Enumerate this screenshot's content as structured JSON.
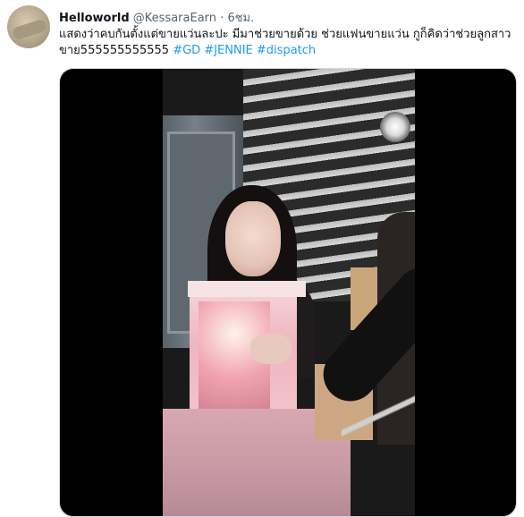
{
  "tweet": {
    "author_name": "Helloworld",
    "author_handle": "@KessaraEarn",
    "separator": "·",
    "time_ago": "6ชม.",
    "text_main": "แสดงว่าคบกันตั้งแต่ขายแว่นละปะ มีมาช่วยขายด้วย ช่วยแฟนขายแว่น กูก็คิดว่าช่วยลูกสาวขาย555555555555",
    "hashtags": [
      "#GD",
      "#JENNIE",
      "#dispatch"
    ]
  },
  "media": {
    "kind": "video-frame",
    "background_color": "#000000"
  }
}
